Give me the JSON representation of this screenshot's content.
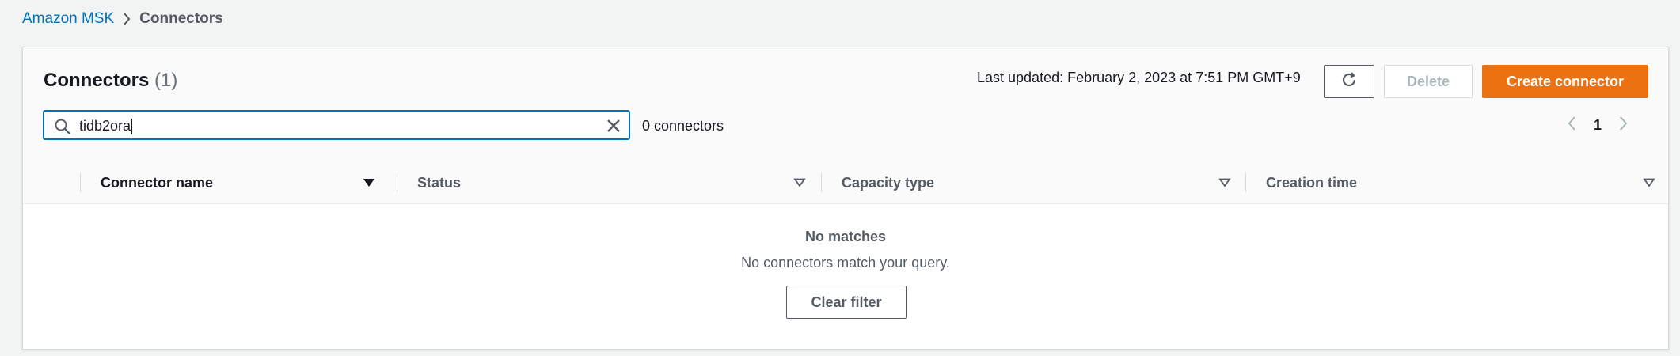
{
  "breadcrumb": {
    "items": [
      "Amazon MSK",
      "Connectors"
    ]
  },
  "panel": {
    "title": "Connectors",
    "count": "(1)",
    "last_updated": "Last updated: February 2, 2023 at 7:51 PM GMT+9",
    "buttons": {
      "refresh_icon": "refresh-icon",
      "delete": "Delete",
      "create": "Create connector"
    }
  },
  "search": {
    "value": "tidb2ora",
    "icon": "search-icon",
    "clear_icon": "close-icon",
    "match_count": "0 connectors"
  },
  "pagination": {
    "current_page": "1"
  },
  "table": {
    "columns": [
      "Connector name",
      "Status",
      "Capacity type",
      "Creation time"
    ],
    "sorted_column": "Connector name"
  },
  "empty_state": {
    "title": "No matches",
    "description": "No connectors match your query.",
    "clear_button": "Clear filter"
  },
  "colors": {
    "accent": "#ec7211",
    "link": "#0073bb",
    "focus_border": "#0073bb"
  }
}
